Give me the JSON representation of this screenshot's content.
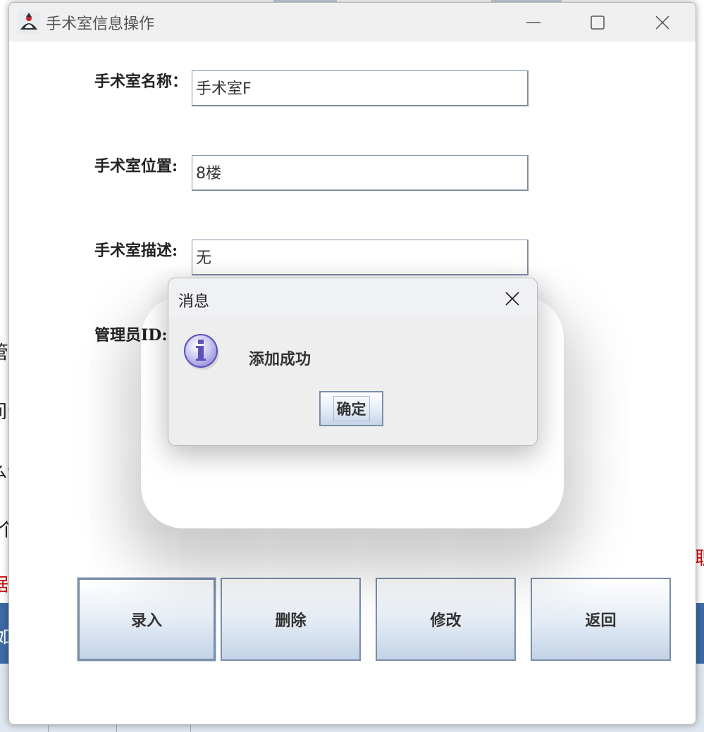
{
  "window": {
    "title": "手术室信息操作"
  },
  "form": {
    "name_label": "手术室名称：",
    "name_value": "手术室F",
    "location_label": "手术室位置:",
    "location_value": "8楼",
    "description_label": "手术室描述:",
    "description_value": "无",
    "admin_label": "管理员ID:"
  },
  "buttons": {
    "enter": "录入",
    "delete": "删除",
    "modify": "修改",
    "back": "返回"
  },
  "dialog": {
    "title": "消息",
    "message": "添加成功",
    "ok_label": "确定"
  },
  "background_fragments": {
    "frag1": "管",
    "frag2": "间资",
    "frag3": "么信",
    "frag4": "个",
    "frag5": "据",
    "frag6": "如",
    "frag7": "职"
  },
  "colors": {
    "button_border": "#7a8ea8",
    "background_bar": "#3c6aa8",
    "background_red_text": "#d40000"
  }
}
